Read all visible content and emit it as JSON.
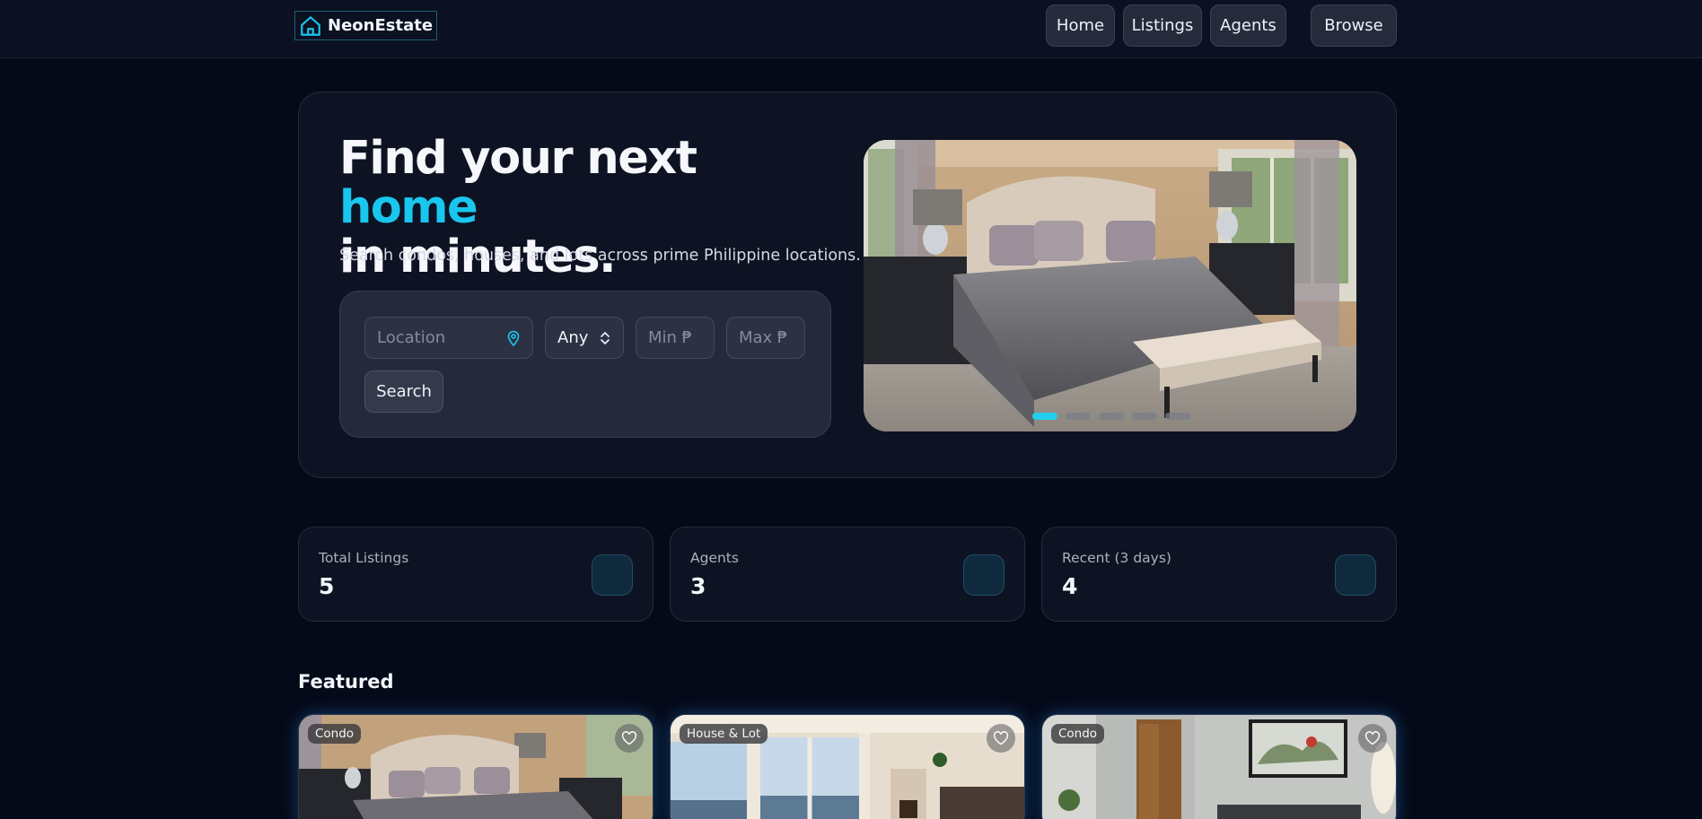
{
  "nav": {
    "brand": "NeonEstate",
    "links": [
      "Home",
      "Listings",
      "Agents"
    ],
    "browse_label": "Browse"
  },
  "hero": {
    "headline_pre": "Find your next ",
    "headline_accent": "home",
    "headline_post": "in minutes.",
    "subhead": "Search condos, houses, and lots across prime Philippine locations.",
    "search": {
      "location_placeholder": "Location",
      "type_selected": "Any",
      "min_placeholder": "Min ₱",
      "max_placeholder": "Max ₱",
      "button_label": "Search"
    },
    "carousel": {
      "slide_count": 5,
      "active_index": 0
    }
  },
  "stats": [
    {
      "label": "Total Listings",
      "value": "5"
    },
    {
      "label": "Agents",
      "value": "3"
    },
    {
      "label": "Recent (3 days)",
      "value": "4"
    }
  ],
  "featured": {
    "title": "Featured",
    "cards": [
      {
        "badge": "Condo"
      },
      {
        "badge": "House & Lot"
      },
      {
        "badge": "Condo"
      }
    ]
  },
  "colors": {
    "accent": "#19c6ee",
    "background": "#050a19",
    "panel": "#0e1323"
  }
}
